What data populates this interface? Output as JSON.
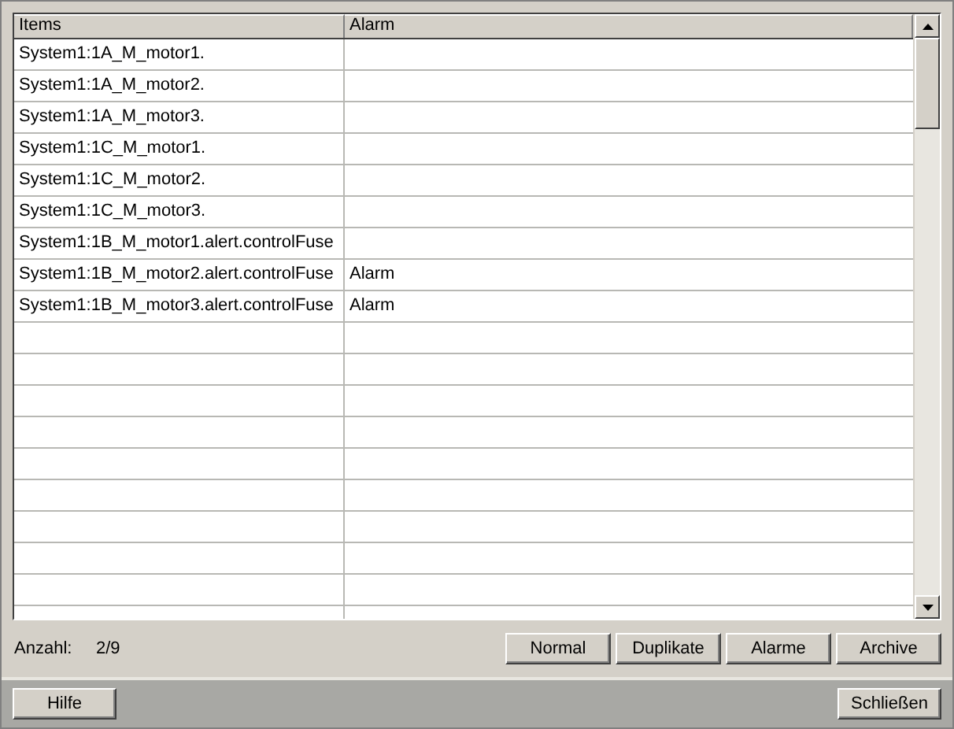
{
  "table": {
    "columns": [
      "Items",
      "Alarm"
    ],
    "rows": [
      {
        "item": "System1:1A_M_motor1.",
        "alarm": ""
      },
      {
        "item": "System1:1A_M_motor2.",
        "alarm": ""
      },
      {
        "item": "System1:1A_M_motor3.",
        "alarm": ""
      },
      {
        "item": "System1:1C_M_motor1.",
        "alarm": ""
      },
      {
        "item": "System1:1C_M_motor2.",
        "alarm": ""
      },
      {
        "item": "System1:1C_M_motor3.",
        "alarm": ""
      },
      {
        "item": "System1:1B_M_motor1.alert.controlFuse",
        "alarm": ""
      },
      {
        "item": "System1:1B_M_motor2.alert.controlFuse",
        "alarm": "Alarm"
      },
      {
        "item": "System1:1B_M_motor3.alert.controlFuse",
        "alarm": "Alarm"
      }
    ]
  },
  "count": {
    "label": "Anzahl:",
    "value": "2/9"
  },
  "filter_buttons": [
    "Normal",
    "Duplikate",
    "Alarme",
    "Archive"
  ],
  "footer_buttons": {
    "help": "Hilfe",
    "close": "Schließen"
  }
}
